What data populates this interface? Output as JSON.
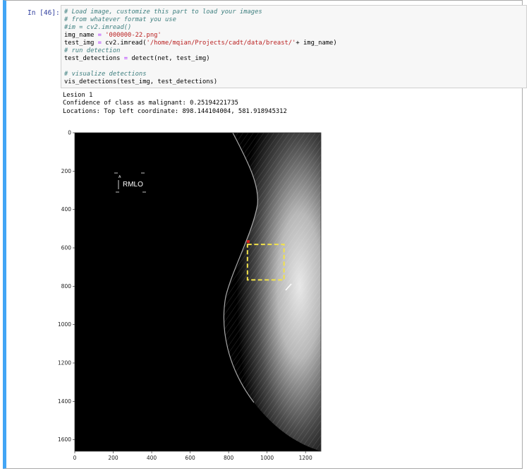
{
  "cell": {
    "prompt": "In [46]:",
    "code_lines": [
      {
        "type": "comment",
        "text": "# Load image, customize this part to load your images"
      },
      {
        "type": "comment",
        "text": "# from whatever format you use"
      },
      {
        "type": "comment",
        "text": "#im = cv2.imread()"
      },
      {
        "type": "assign_str",
        "var": "img_name",
        "op": " = ",
        "str": "'000000-22.png'",
        "rest": ""
      },
      {
        "type": "assign_str",
        "var": "test_img",
        "op": " = ",
        "pre": "cv2.imread(",
        "str": "'/home/mqian/Projects/cadt/data/breast/'",
        "rest": "+ img_name)"
      },
      {
        "type": "comment",
        "text": "# run detection"
      },
      {
        "type": "assign",
        "var": "test_detections",
        "op": " = ",
        "rest": "detect(net, test_img)"
      },
      {
        "type": "blank",
        "text": ""
      },
      {
        "type": "comment",
        "text": "# visualize detections"
      },
      {
        "type": "plain",
        "text": "vis_detections(test_img, test_detections)"
      }
    ],
    "output_lines": [
      "Lesion 1",
      "Confidence of class as malignant: 0.25194221735",
      "Locations: Top left coordinate: 898.144104004, 581.918945312"
    ]
  },
  "figure": {
    "image_label": "RMLO",
    "x_ticks": [
      0,
      200,
      400,
      600,
      800,
      1000,
      1200
    ],
    "y_ticks": [
      0,
      200,
      400,
      600,
      800,
      1000,
      1200,
      1400,
      1600
    ],
    "x_range": [
      0,
      1280
    ],
    "y_range": [
      0,
      1660
    ],
    "detection_box": {
      "x": 898,
      "y": 582,
      "w": 190,
      "h": 185
    },
    "colors": {
      "box": "#f2e24a",
      "marker": "#d7261e",
      "background": "#000000"
    }
  }
}
